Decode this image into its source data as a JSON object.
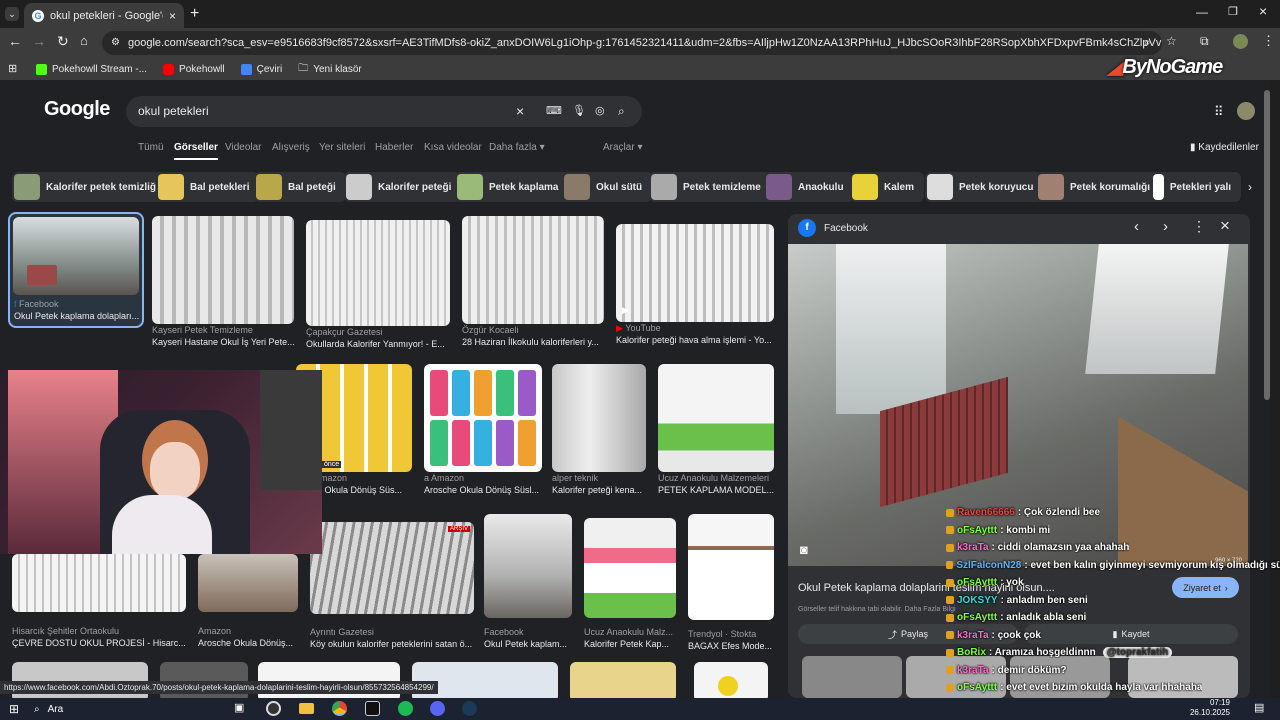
{
  "browser": {
    "tab_title": "okul petekleri - Google'da Ara",
    "url": "google.com/search?sca_esv=e9516683f9cf8572&sxsrf=AE3TifMDfs8-okiZ_anxDOIW6Lg1iOhp-g:1761452321411&udm=2&fbs=AIljpHw1Z0NzAA13RPhHuJ_HJbcSOoR3IhbF28RSopXbhXFDxpvFBmk4sChZlpVvEQVxBuyKbA3d1NqFtv9UenRbsxC7...",
    "bookmarks": [
      "Pokehowll Stream -...",
      "Pokehowll",
      "Çeviri",
      "Yeni klasör"
    ],
    "overlay_brand": "ByNoGame"
  },
  "search": {
    "logo": "Google",
    "query": "okul petekleri",
    "nav_tabs": [
      "Tümü",
      "Görseller",
      "Videolar",
      "Alışveriş",
      "Yer siteleri",
      "Haberler",
      "Kısa videolar",
      "Daha fazla"
    ],
    "tools_label": "Araçlar",
    "saved_label": "Kaydedilenler"
  },
  "chips": [
    "Kalorifer petek temizliği",
    "Bal petekleri",
    "Bal peteği",
    "Kalorifer peteği",
    "Petek kaplama",
    "Okul sütü",
    "Petek temizleme",
    "Anaokulu",
    "Kalem",
    "Petek koruyucu",
    "Petek korumalığı",
    "Petekleri yalı"
  ],
  "results": [
    {
      "source": "Facebook",
      "title": "Okul Petek kaplama dolapları..."
    },
    {
      "source": "Kayseri Petek Temizleme",
      "title": "Kayseri Hastane Okul İş Yeri Pete..."
    },
    {
      "source": "Çapakçur Gazetesi",
      "title": "Okullarda Kalorifer Yanmıyor! - E..."
    },
    {
      "source": "Özgür Kocaeli",
      "title": "28 Haziran İlkokulu kaloriferleri y..."
    },
    {
      "source": "YouTube",
      "title": "Kalorifer peteği hava alma işlemi - Yo..."
    },
    {
      "source": "mazon",
      "title": "he Okula Dönüş Süs..."
    },
    {
      "source": "Amazon",
      "title": "Arosche Okula Dönüş Süsl..."
    },
    {
      "source": "alper teknik",
      "title": "Kalorifer peteği kena..."
    },
    {
      "source": "Ucuz Anaokulu Malzemeleri",
      "title": "PETEK KAPLAMA MODEL..."
    },
    {
      "source": "Hisarcık Şehitler Ortaokulu",
      "title": "ÇEVRE DOSTU OKUL PROJESİ - Hisarc..."
    },
    {
      "source": "Amazon",
      "title": "Arosche Okula Dönüş..."
    },
    {
      "source": "Ayrıntı Gazetesi",
      "title": "Köy okulun kalorifer peteklerini satan ö..."
    },
    {
      "source": "Facebook",
      "title": "Okul Petek kaplam..."
    },
    {
      "source": "Ucuz Anaokulu Malz...",
      "title": "Kalorifer Petek Kap..."
    },
    {
      "source": "Trendyol · Stokta",
      "title": "BAGAX Efes Mode..."
    }
  ],
  "badges": {
    "once": "önce",
    "arsiv": "ARŞİV"
  },
  "panel": {
    "source": "Facebook",
    "title": "Okul Petek kaplama dolaplarini teslim hayirli olsun....",
    "visit_label": "Ziyaret et",
    "copyright": "Görseller telif hakkına tabi olabilir.",
    "more_info": "Daha Fazla Bilgi",
    "share_label": "Paylaş",
    "save_label": "Kaydet",
    "dims": "960 × 720"
  },
  "chat": [
    {
      "user": "Raven66666",
      "msg": ": Çok özlendi bee",
      "color": "#e0473a"
    },
    {
      "user": "oFsAyttt",
      "msg": ": kombi mi",
      "color": "#7fff3a"
    },
    {
      "user": "k3raTa",
      "msg": ": ciddi olamazsın yaa ahahah",
      "color": "#ff6bcb"
    },
    {
      "user": "SzlFalconN28",
      "msg": ": evet ben kalın giyinmeyi sevmiyorum kış olmadığı süreçe",
      "color": "#5fb7ff"
    },
    {
      "user": "oFsAyttt",
      "msg": ": yok",
      "color": "#7fff3a"
    },
    {
      "user": "JOKSYY",
      "msg": ": anladım ben seni",
      "color": "#38d9d9"
    },
    {
      "user": "oFsAyttt",
      "msg": ": anladık abla seni",
      "color": "#7fff3a"
    },
    {
      "user": "k3raTa",
      "msg": ": çook çok",
      "color": "#ff6bcb"
    },
    {
      "user": "BoRix",
      "msg": ": Aramıza hoşgeldinnn",
      "color": "#7fff3a"
    },
    {
      "user": "k3raTa",
      "msg": ": demir döküm?",
      "color": "#ff6bcb"
    },
    {
      "user": "oFsAyttt",
      "msg": ": evet evet bizim okulda hayla var hhahaha",
      "color": "#7fff3a"
    }
  ],
  "chat_mention": "@toprakfatih",
  "status_url": "https://www.facebook.com/Abdi.Oztoprak.70/posts/okul-petek-kaplama-dolaplarini-teslim-hayirli-olsun/855732564854299/",
  "taskbar": {
    "search": "Ara",
    "time": "07:19",
    "date": "26.10.2025"
  }
}
